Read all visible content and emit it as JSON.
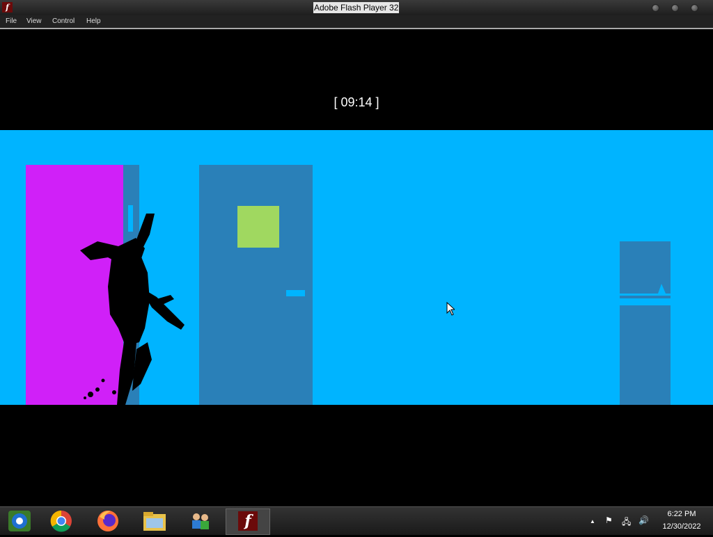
{
  "window": {
    "title": "Adobe Flash Player 32",
    "icon": "flash-icon",
    "app_icon_letter": "f"
  },
  "menu": {
    "items": [
      "File",
      "View",
      "Control",
      "Help"
    ]
  },
  "game": {
    "timer": "[ 09:14 ]",
    "colors": {
      "sky": "#00b4ff",
      "door_blue": "#2a80b8",
      "door_magenta": "#d020f8",
      "window_green": "#a0d860",
      "silhouette": "#000000"
    }
  },
  "taskbar": {
    "apps": [
      "start-orb-icon",
      "chrome-icon",
      "firefox-icon",
      "file-explorer-icon",
      "network-people-icon",
      "flash-player-icon"
    ],
    "active_app_letter": "f",
    "tray": {
      "show_hidden": "▲",
      "flag": "⚑",
      "network": "🖧",
      "volume": "🔊"
    },
    "clock": {
      "time": "6:22 PM",
      "date": "12/30/2022"
    }
  }
}
